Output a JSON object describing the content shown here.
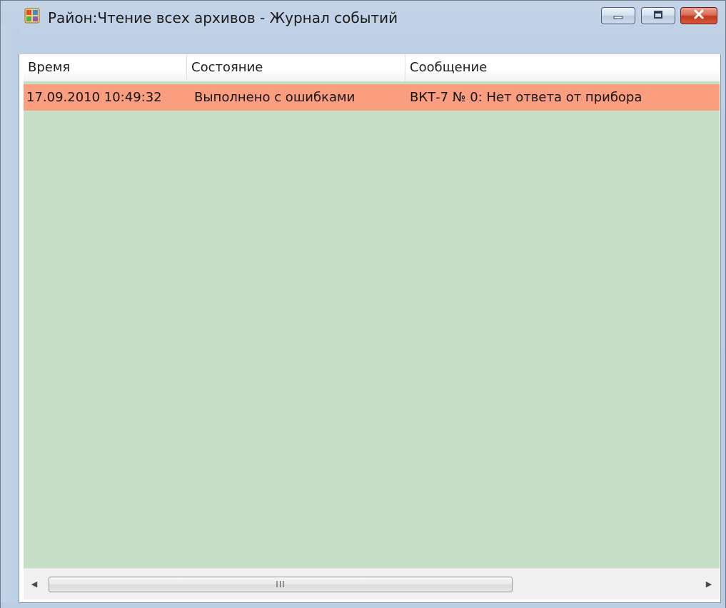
{
  "window": {
    "title": "Район:Чтение всех архивов - Журнал событий",
    "icon": "journal-icon"
  },
  "controls": {
    "minimize": "minimize-icon",
    "maximize": "maximize-icon",
    "close": "close-icon"
  },
  "table": {
    "columns": [
      "Время",
      "Состояние",
      "Сообщение"
    ],
    "rows": [
      {
        "time": "17.09.2010 10:49:32",
        "status": "Выполнено с ошибками",
        "message": "ВКТ-7 № 0: Нет ответа от прибора",
        "highlight_color": "#fb9d7f"
      }
    ],
    "background_color": "#c6dfc6"
  },
  "scrollbar": {
    "grip": "III",
    "left_arrow": "◀",
    "right_arrow": "▶"
  }
}
